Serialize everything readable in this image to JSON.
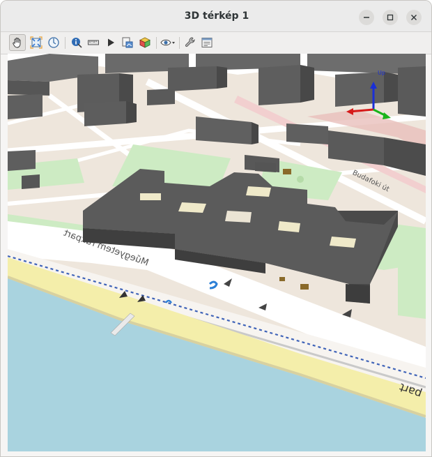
{
  "window": {
    "title": "3D térkép 1"
  },
  "toolbar": {
    "tools": [
      {
        "id": "pan",
        "icon": "pan-hand-icon",
        "active": true
      },
      {
        "id": "zoom-full",
        "icon": "zoom-full-icon"
      },
      {
        "id": "north",
        "icon": "compass-icon"
      },
      {
        "id": "identify",
        "icon": "identify-icon"
      },
      {
        "id": "measure",
        "icon": "measure-ruler-icon"
      },
      {
        "id": "animation",
        "icon": "play-icon"
      },
      {
        "id": "export",
        "icon": "export-image-icon"
      },
      {
        "id": "3d-layer",
        "icon": "cube-icon"
      },
      {
        "id": "camera",
        "icon": "eye-icon"
      },
      {
        "id": "options",
        "icon": "wrench-icon"
      },
      {
        "id": "settings",
        "icon": "settings-window-icon"
      }
    ]
  },
  "map": {
    "labels": {
      "riverbank_street": "Műegyetem rakpart",
      "road_name": "Budafoki út",
      "road_name_right": "part"
    },
    "colors": {
      "water": "#a9d3df",
      "sand": "#f4eeaa",
      "park": "#cdebc3",
      "buildings": "#595959",
      "street": "#ffffff",
      "urban": "#efe6dc"
    },
    "axes": {
      "up_label": "Up"
    }
  }
}
